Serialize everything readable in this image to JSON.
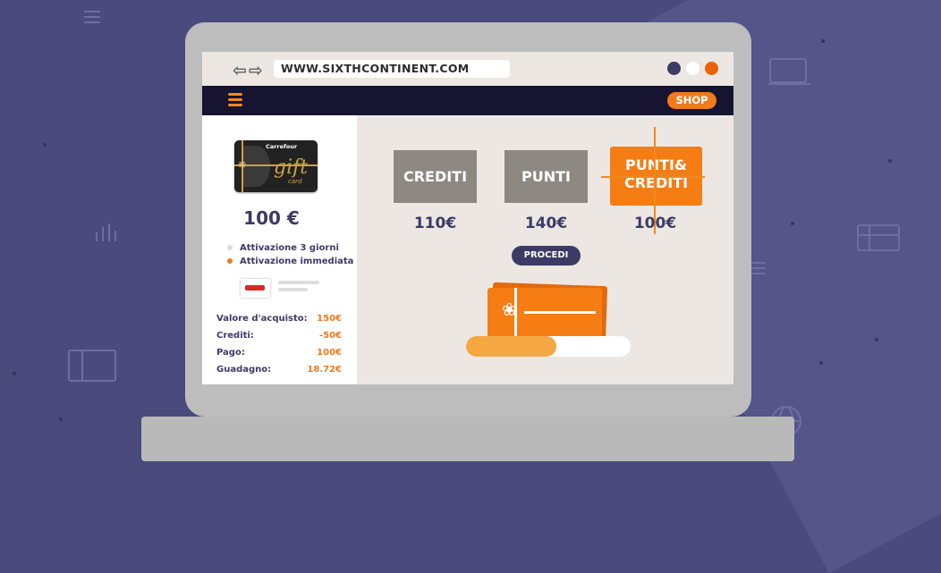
{
  "browser": {
    "url": "WWW.SIXTHCONTINENT.COM",
    "window_dots": [
      "#3d3a66",
      "#ffffff",
      "#e8640c"
    ]
  },
  "site_nav": {
    "shop_label": "SHOP"
  },
  "product": {
    "card_brand": "Carrefour",
    "card_text": "gift",
    "card_subtext": "card",
    "amount": "100 €",
    "activation_options": [
      {
        "label": "Attivazione 3 giorni",
        "color": "#dcdcdc"
      },
      {
        "label": "Attivazione immediata",
        "color": "#ef7a1e"
      }
    ],
    "summary": [
      {
        "label": "Valore d'acquisto:",
        "value": "150€"
      },
      {
        "label": "Crediti:",
        "value": "-50€"
      },
      {
        "label": "Pago:",
        "value": "100€"
      },
      {
        "label": "Guadagno:",
        "value": "18.72€"
      }
    ]
  },
  "payment_options": [
    {
      "label": "CREDITI",
      "price": "110€",
      "active": false
    },
    {
      "label": "PUNTI",
      "price": "140€",
      "active": false
    },
    {
      "label": "PUNTI& CREDITI",
      "price": "100€",
      "active": true
    }
  ],
  "procedi_label": "PROCEDI",
  "progress_fraction": 0.55,
  "colors": {
    "accent": "#f57d14",
    "navy": "#3d3a66",
    "option_gray": "#8e8883"
  }
}
